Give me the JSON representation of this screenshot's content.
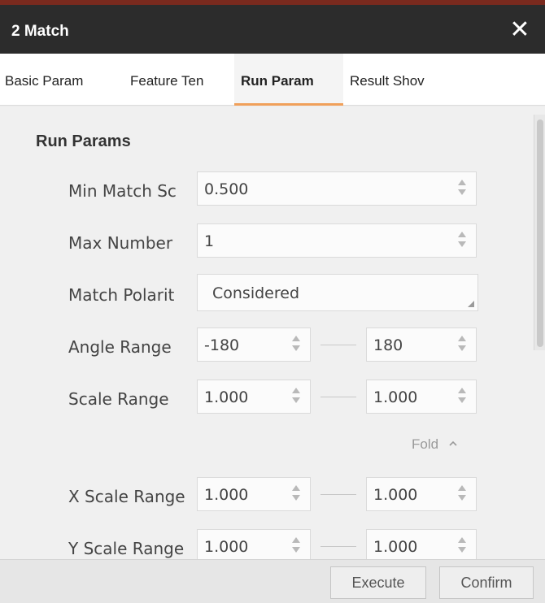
{
  "window": {
    "title": "2 Match",
    "close_icon": "close-icon"
  },
  "tabs": [
    {
      "label": "Basic Param",
      "active": false
    },
    {
      "label": "Feature Ten",
      "active": false
    },
    {
      "label": "Run Param",
      "active": true
    },
    {
      "label": "Result Shov",
      "active": false
    }
  ],
  "section": {
    "title": "Run Params"
  },
  "params": {
    "min_match_score": {
      "label": "Min Match Sc",
      "value": "0.500"
    },
    "max_number": {
      "label": "Max Number",
      "value": "1"
    },
    "match_polarity": {
      "label": "Match Polarit",
      "value": "Considered"
    },
    "angle_range": {
      "label": "Angle Range",
      "min": "-180",
      "max": "180"
    },
    "scale_range": {
      "label": "Scale Range",
      "min": "1.000",
      "max": "1.000"
    },
    "x_scale_range": {
      "label": "X Scale Range",
      "min": "1.000",
      "max": "1.000"
    },
    "y_scale_range": {
      "label": "Y Scale Range",
      "min": "1.000",
      "max": "1.000"
    }
  },
  "fold": {
    "label": "Fold",
    "icon": "chevron-up-icon"
  },
  "footer": {
    "execute_label": "Execute",
    "confirm_label": "Confirm"
  },
  "colors": {
    "titlebar": "#2c2c2c",
    "active_tab_underline": "#f0a05a"
  }
}
